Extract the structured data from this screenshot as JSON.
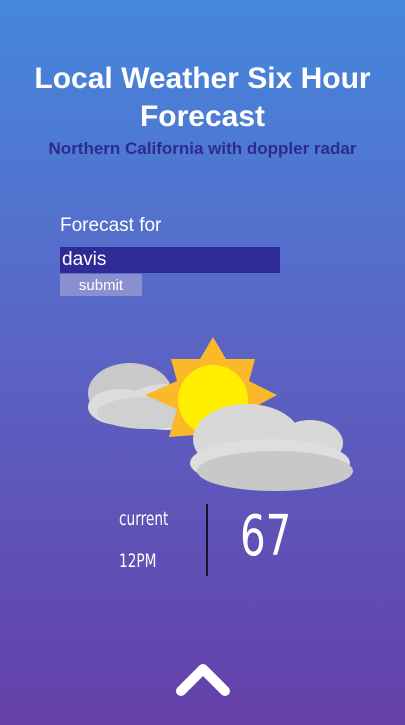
{
  "header": {
    "title": "Local Weather Six Hour Forecast",
    "subtitle": "Northern California with doppler radar"
  },
  "form": {
    "label": "Forecast for",
    "location_value": "davis",
    "submit_label": "submit"
  },
  "weather": {
    "icon": "partly-cloudy-icon",
    "current_label": "current",
    "time": "12PM",
    "temperature": "67"
  },
  "navigation": {
    "scroll_icon": "chevron-up-icon"
  },
  "colors": {
    "background_top": "#4488dc",
    "background_bottom": "#6440a8",
    "subtitle": "#2e2b8f",
    "input_background": "#2f2b96",
    "button_background": "#8a8fd0",
    "sun": "#ffee00",
    "sun_rays": "#fbb829",
    "cloud": "#d8d8d8"
  }
}
